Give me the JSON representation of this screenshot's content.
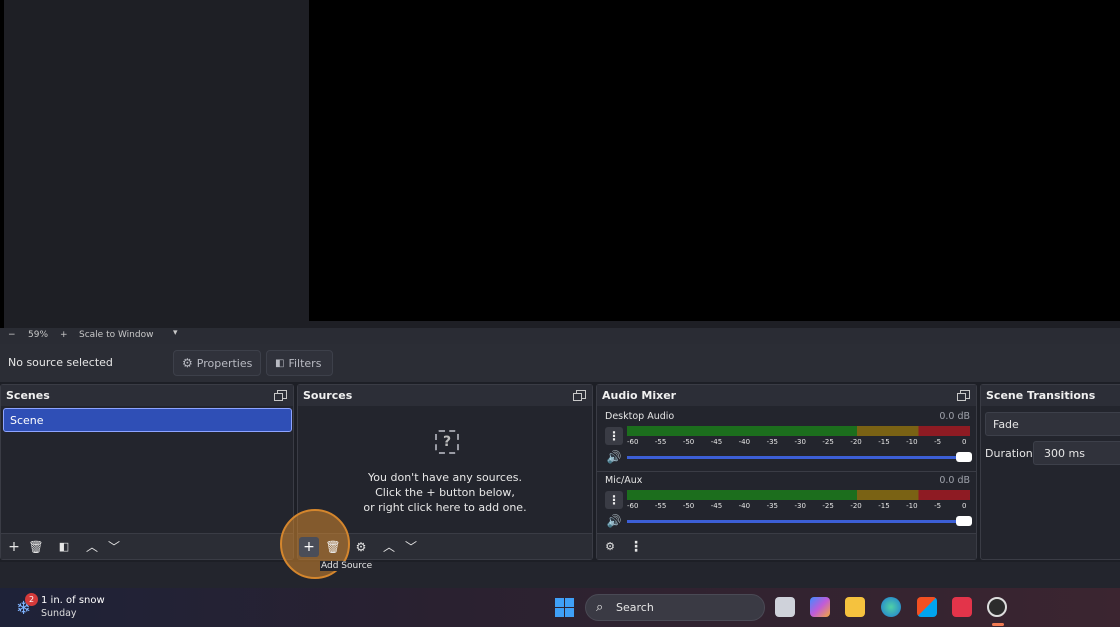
{
  "zoom_bar": {
    "minus": "−",
    "zoom": "59%",
    "plus": "+",
    "scale_mode": "Scale to Window",
    "dropdown_icon": "caret-down-icon"
  },
  "source_bar": {
    "status": "No source selected",
    "properties": "Properties",
    "filters": "Filters"
  },
  "scenes": {
    "title": "Scenes",
    "items": [
      "Scene"
    ],
    "selected": "Scene"
  },
  "sources": {
    "title": "Sources",
    "empty_line1": "You don't have any sources.",
    "empty_line2": "Click the + button below,",
    "empty_line3": "or right click here to add one.",
    "empty_icon": "?"
  },
  "audio_mixer": {
    "title": "Audio Mixer",
    "ticks": [
      "-60",
      "-55",
      "-50",
      "-45",
      "-40",
      "-35",
      "-30",
      "-25",
      "-20",
      "-15",
      "-10",
      "-5",
      "0"
    ],
    "channels": [
      {
        "name": "Desktop Audio",
        "level": "0.0 dB",
        "volume_fraction": 1.0
      },
      {
        "name": "Mic/Aux",
        "level": "0.0 dB",
        "volume_fraction": 1.0
      }
    ]
  },
  "transitions": {
    "title": "Scene Transitions",
    "selected": "Fade",
    "duration_label": "Duration",
    "duration_value": "300 ms"
  },
  "tooltip": "Add Source",
  "taskbar": {
    "weather_temp_text": "1 in. of snow",
    "weather_day": "Sunday",
    "weather_badge": "2",
    "search_placeholder": "Search"
  },
  "colors": {
    "accent": "#2f4fb6",
    "highlight": "#d4862d",
    "meter_green": "#1c6e1d",
    "meter_yellow": "#7a6214",
    "meter_red": "#8e1b23"
  }
}
